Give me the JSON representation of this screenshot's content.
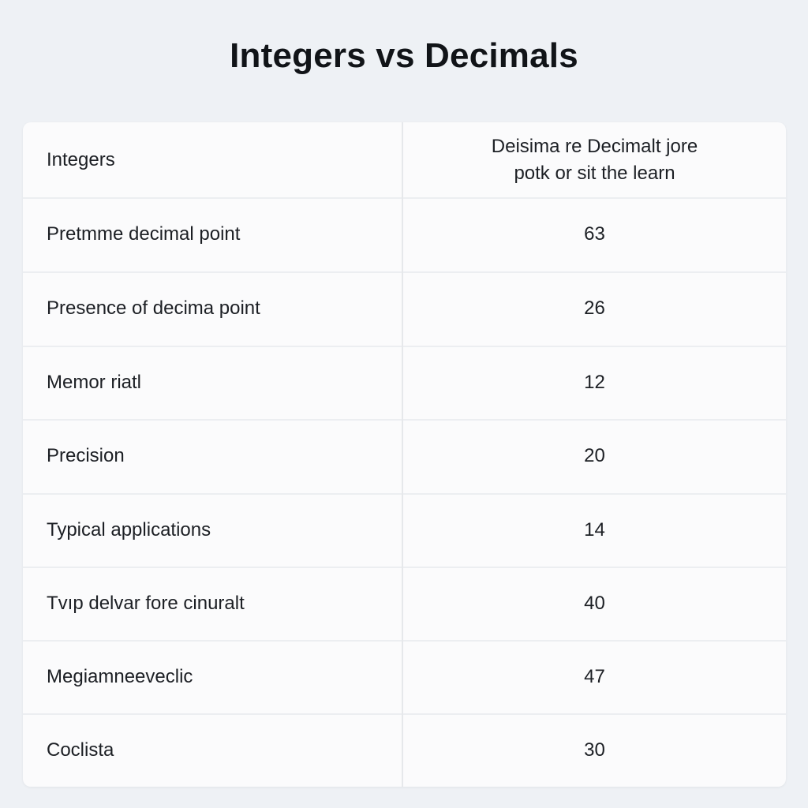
{
  "title": "Integers vs Decimals",
  "table": {
    "header": {
      "left": "Integers",
      "right_line1": "Deisima re Decimalt jore",
      "right_line2": "potk or sit the learn"
    },
    "rows": [
      {
        "label": "Pretmme decimal point",
        "value": "63"
      },
      {
        "label": "Presence of decima point",
        "value": "26"
      },
      {
        "label": "Memor riatl",
        "value": "12"
      },
      {
        "label": "Precision",
        "value": "20"
      },
      {
        "label": "Typical applications",
        "value": "14"
      },
      {
        "label": "Tvıp delvar fore cinuralt",
        "value": "40"
      },
      {
        "label": "Megiamneeveclic",
        "value": "47"
      },
      {
        "label": "Coclista",
        "value": "30"
      }
    ]
  }
}
